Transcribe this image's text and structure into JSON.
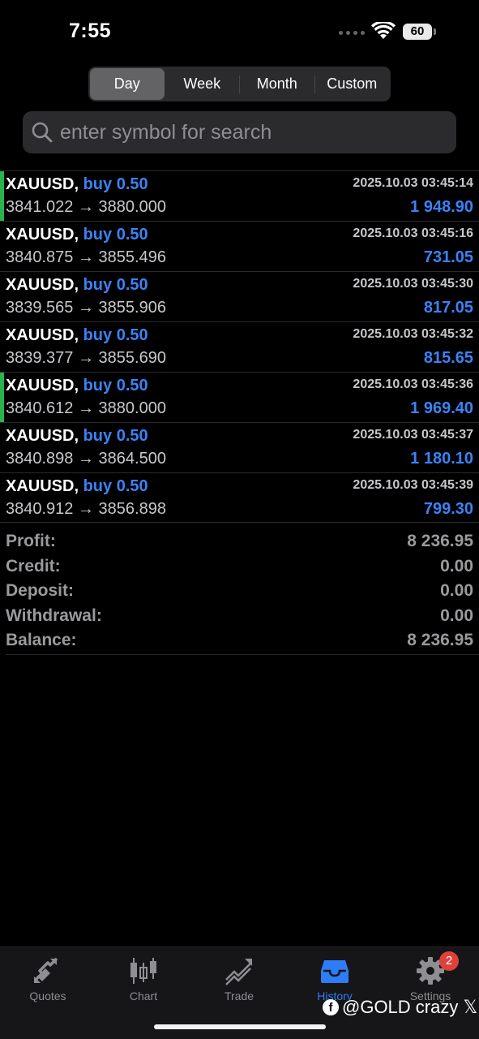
{
  "status_bar": {
    "time": "7:55",
    "battery": "60"
  },
  "period_tabs": [
    {
      "label": "Day",
      "active": true
    },
    {
      "label": "Week",
      "active": false
    },
    {
      "label": "Month",
      "active": false
    },
    {
      "label": "Custom",
      "active": false
    }
  ],
  "search": {
    "placeholder": "enter symbol for search",
    "value": ""
  },
  "trades": [
    {
      "symbol": "XAUUSD",
      "type": "buy",
      "volume": "0.50",
      "open_price": "3841.022",
      "close_price": "3880.000",
      "time": "2025.10.03 03:45:14",
      "profit": "1 948.90",
      "tp_hit": true
    },
    {
      "symbol": "XAUUSD",
      "type": "buy",
      "volume": "0.50",
      "open_price": "3840.875",
      "close_price": "3855.496",
      "time": "2025.10.03 03:45:16",
      "profit": "731.05",
      "tp_hit": false
    },
    {
      "symbol": "XAUUSD",
      "type": "buy",
      "volume": "0.50",
      "open_price": "3839.565",
      "close_price": "3855.906",
      "time": "2025.10.03 03:45:30",
      "profit": "817.05",
      "tp_hit": false
    },
    {
      "symbol": "XAUUSD",
      "type": "buy",
      "volume": "0.50",
      "open_price": "3839.377",
      "close_price": "3855.690",
      "time": "2025.10.03 03:45:32",
      "profit": "815.65",
      "tp_hit": false
    },
    {
      "symbol": "XAUUSD",
      "type": "buy",
      "volume": "0.50",
      "open_price": "3840.612",
      "close_price": "3880.000",
      "time": "2025.10.03 03:45:36",
      "profit": "1 969.40",
      "tp_hit": true
    },
    {
      "symbol": "XAUUSD",
      "type": "buy",
      "volume": "0.50",
      "open_price": "3840.898",
      "close_price": "3864.500",
      "time": "2025.10.03 03:45:37",
      "profit": "1 180.10",
      "tp_hit": false
    },
    {
      "symbol": "XAUUSD",
      "type": "buy",
      "volume": "0.50",
      "open_price": "3840.912",
      "close_price": "3856.898",
      "time": "2025.10.03 03:45:39",
      "profit": "799.30",
      "tp_hit": false
    }
  ],
  "summary": [
    {
      "label": "Profit:",
      "value": "8 236.95"
    },
    {
      "label": "Credit:",
      "value": "0.00"
    },
    {
      "label": "Deposit:",
      "value": "0.00"
    },
    {
      "label": "Withdrawal:",
      "value": "0.00"
    },
    {
      "label": "Balance:",
      "value": "8 236.95"
    }
  ],
  "tab_bar": [
    {
      "label": "Quotes",
      "icon": "quotes-icon",
      "active": false
    },
    {
      "label": "Chart",
      "icon": "chart-icon",
      "active": false
    },
    {
      "label": "Trade",
      "icon": "trade-icon",
      "active": false
    },
    {
      "label": "History",
      "icon": "history-icon",
      "active": true
    },
    {
      "label": "Settings",
      "icon": "settings-icon",
      "active": false,
      "badge": "2"
    }
  ],
  "watermark": {
    "text": "@GOLD crazy 𝕏"
  },
  "colors": {
    "accent": "#3b82f6",
    "active_tab": "#2e7cf6",
    "tp_marker": "#2bb24c",
    "badge": "#e0403a"
  }
}
